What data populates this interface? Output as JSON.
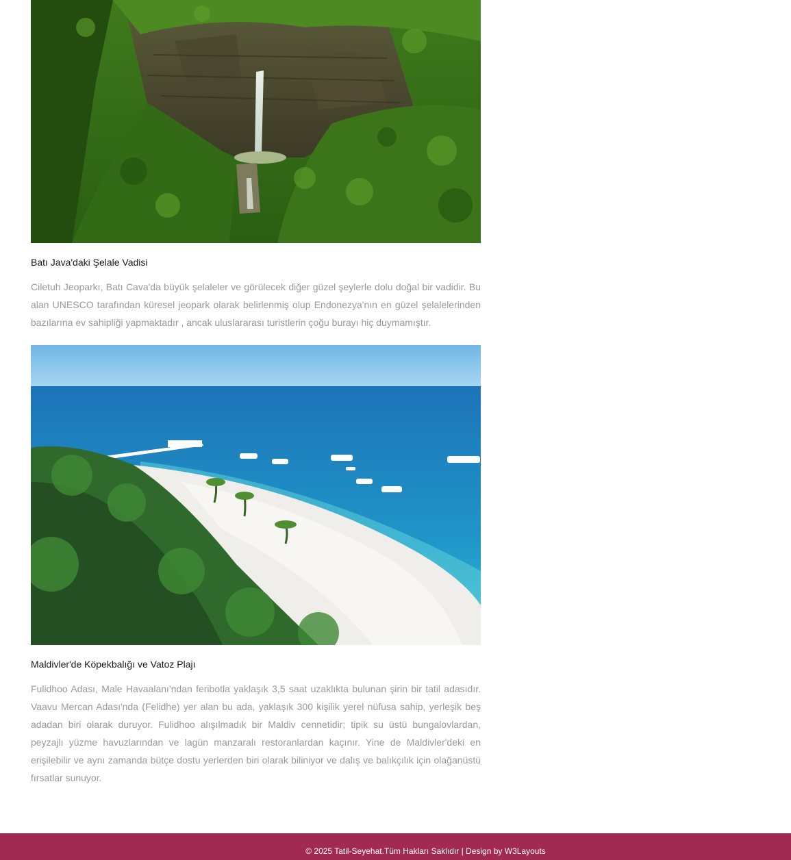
{
  "articles": [
    {
      "image_alt": "waterfall-valley",
      "title": "Batı Java'daki Şelale Vadisi",
      "text": "Ciletuh Jeoparkı, Batı Cava'da büyük şelaleler ve görülecek diğer güzel şeylerle dolu doğal bir vadidir. Bu alan UNESCO tarafından küresel jeopark olarak belirlenmiş olup Endonezya'nın en güzel şelalelerinden bazılarına ev sahipliği yapmaktadır , ancak uluslararası turistlerin çoğu burayı hiç duymamıştır."
    },
    {
      "image_alt": "maldives-beach",
      "title": "Maldivler'de Köpekbalığı ve Vatoz Plajı",
      "text": "Fulidhoo Adası, Male Havaalanı'ndan feribotla yaklaşık 3,5 saat uzaklıkta bulunan şirin bir tatil adasıdır. Vaavu Mercan Adası'nda (Felidhe) yer alan bu ada, yaklaşık 300 kişilik yerel nüfusa sahip, yerleşik beş adadan biri olarak duruyor. Fulidhoo alışılmadık bir Maldiv cennetidir; tipik su üstü bungalovlardan, peyzajlı yüzme havuzlarından ve lagün manzaralı restoranlardan kaçınır. Yine de Maldivler'deki en erişilebilir ve aynı zamanda bütçe dostu yerlerden biri olarak biliniyor ve dalış ve balıkçılık için olağanüstü fırsatlar sunuyor."
    }
  ],
  "footer": {
    "copyright": "© 2025 Tatil-Seyehat.Tüm Hakları Saklıdır | Design by ",
    "link_label": "W3Layouts"
  },
  "colors": {
    "footer_bg": "#a02a52",
    "body_text": "#999999",
    "title_text": "#1a1a1a"
  }
}
